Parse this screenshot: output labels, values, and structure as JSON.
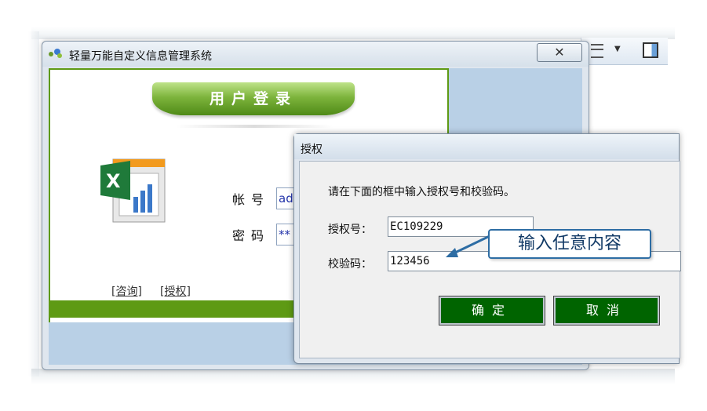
{
  "main_window": {
    "title": "轻量万能自定义信息管理系统",
    "close_glyph": "✕",
    "banner": "用户登录",
    "account_label": "帐号",
    "account_value": "ad",
    "password_label": "密码",
    "password_value": "**",
    "link_consult": "[咨询]",
    "link_authorize": "[授权]"
  },
  "auth_dialog": {
    "title": "授权",
    "instruction": "请在下面的框中输入授权号和校验码。",
    "auth_no_label": "授权号：",
    "auth_no_value": "EC109229",
    "check_code_label": "校验码：",
    "check_code_value": "123456",
    "ok_label": "确定",
    "cancel_label": "取消"
  },
  "annotation": {
    "callout_text": "输入任意内容"
  },
  "background_window": {
    "toolbar_icons": [
      "list-view-icon",
      "chevron-down-icon",
      "preview-pane-icon"
    ]
  },
  "colors": {
    "brand_green": "#5e9a14",
    "button_green": "#006400",
    "callout_border": "#2e6da4"
  }
}
